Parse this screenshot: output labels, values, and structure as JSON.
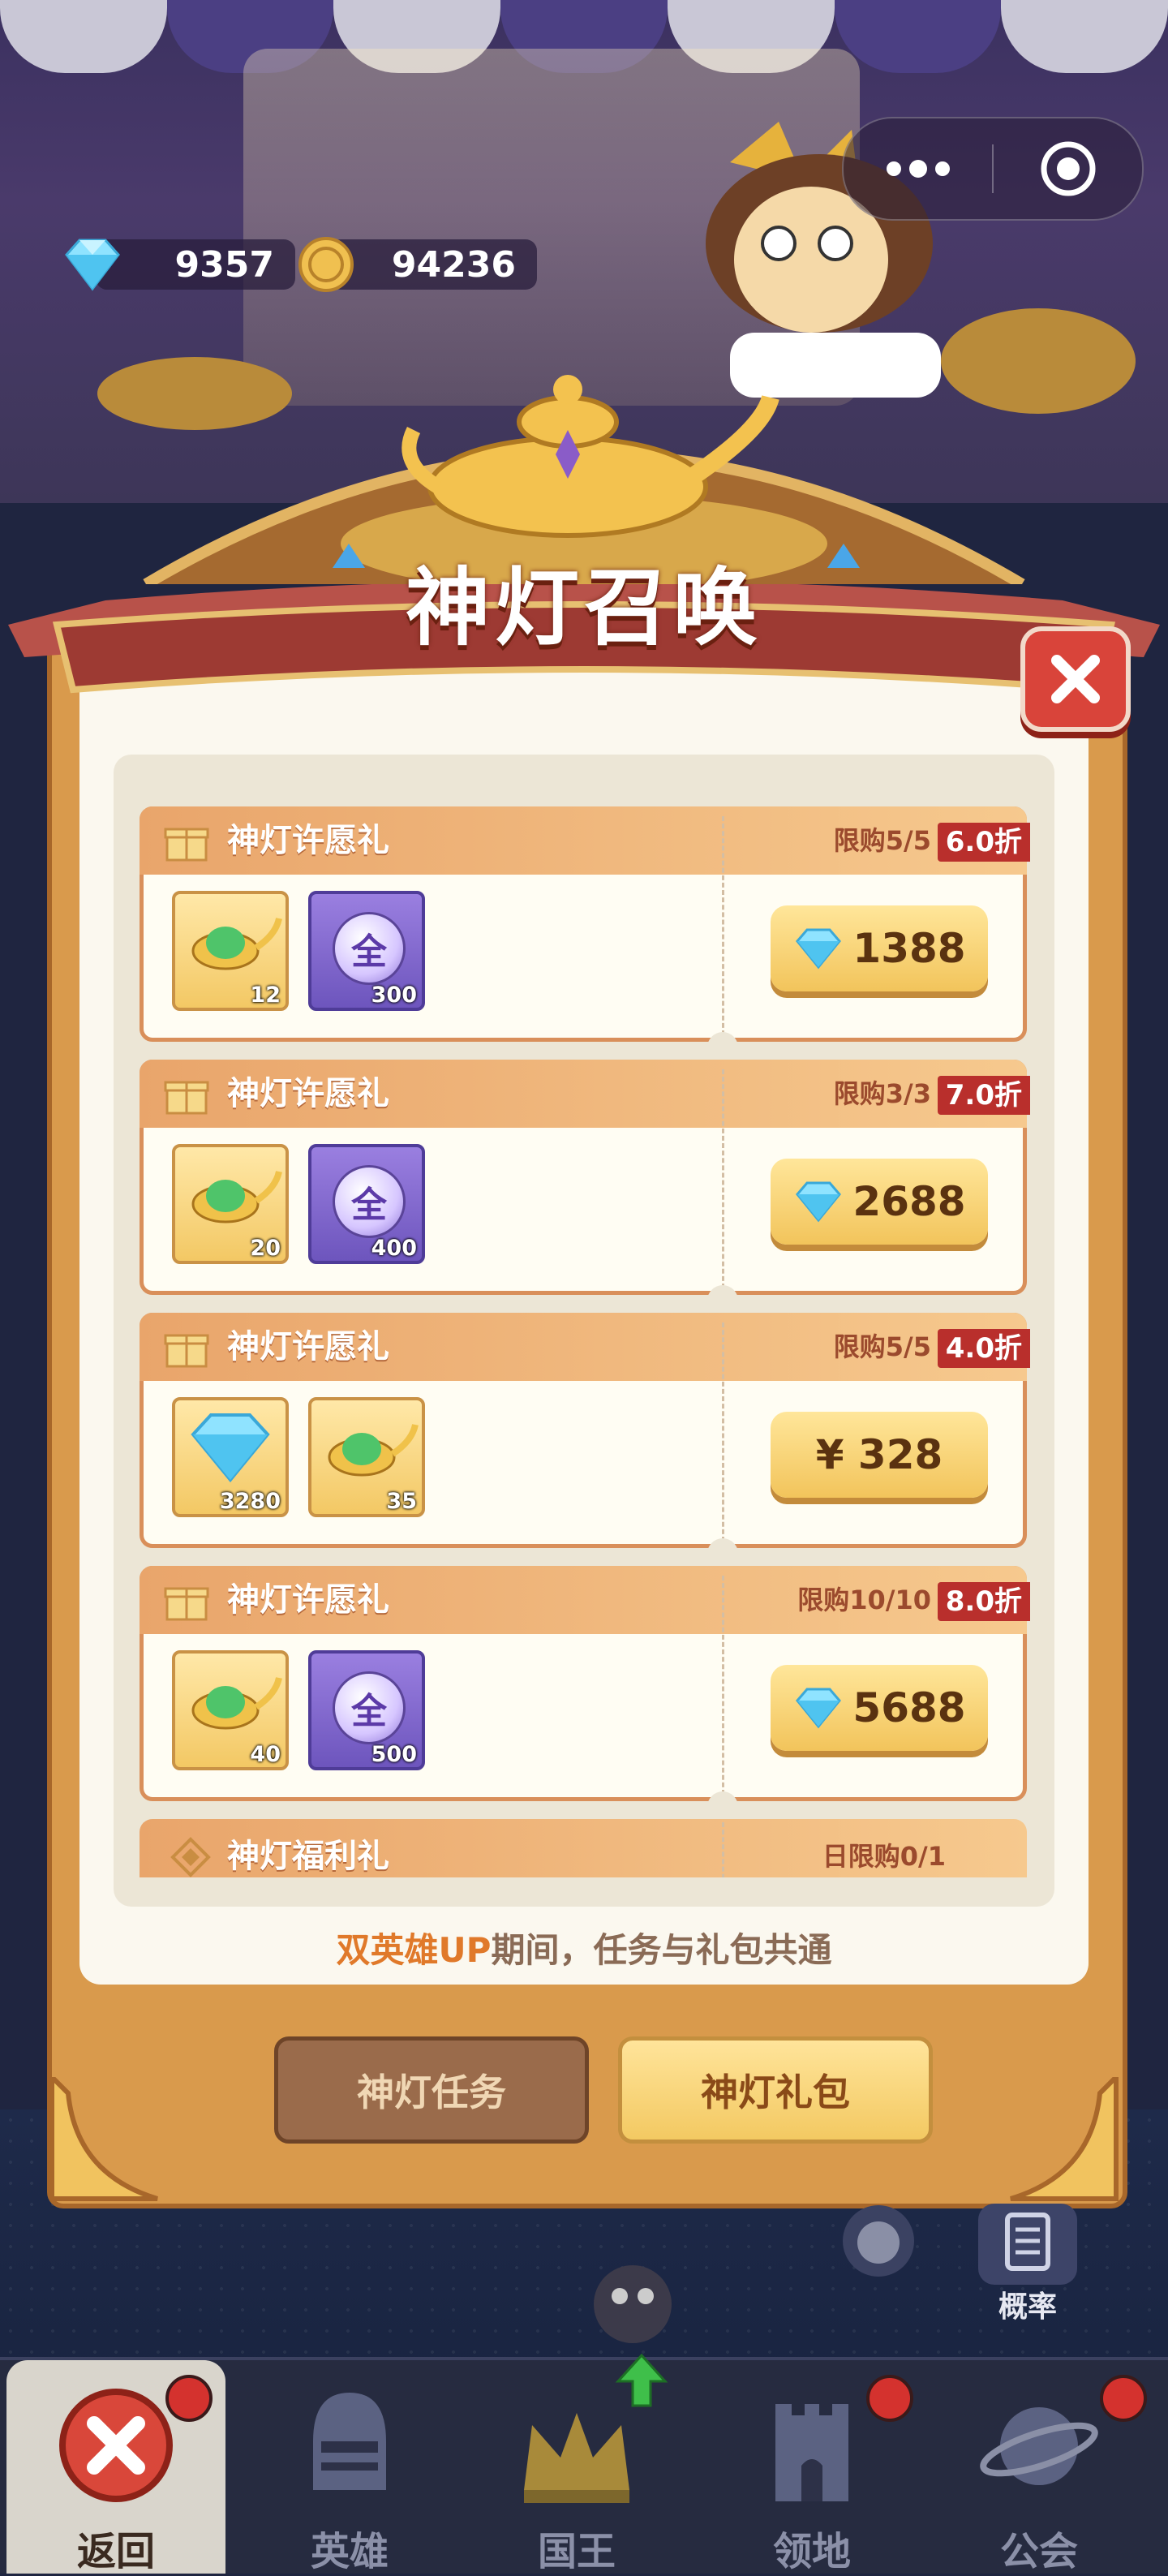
{
  "currency": {
    "gems": "9357",
    "coins": "94236"
  },
  "window_controls": {
    "more_icon": "more-dots-icon",
    "close_icon": "target-circle-icon"
  },
  "panel": {
    "title": "神灯召唤",
    "close_icon": "close-x-icon"
  },
  "gift_packs": [
    {
      "title": "神灯许愿礼",
      "limit": "限购5/5",
      "discount": "6.0折",
      "items": [
        {
          "icon": "magic-lamp-icon",
          "qty": "12"
        },
        {
          "icon": "all-hero-orb-icon",
          "qty": "300"
        }
      ],
      "price_icon": "gem-icon",
      "price": "1388"
    },
    {
      "title": "神灯许愿礼",
      "limit": "限购3/3",
      "discount": "7.0折",
      "items": [
        {
          "icon": "magic-lamp-icon",
          "qty": "20"
        },
        {
          "icon": "all-hero-orb-icon",
          "qty": "400"
        }
      ],
      "price_icon": "gem-icon",
      "price": "2688"
    },
    {
      "title": "神灯许愿礼",
      "limit": "限购5/5",
      "discount": "4.0折",
      "items": [
        {
          "icon": "gem-icon",
          "qty": "3280"
        },
        {
          "icon": "magic-lamp-icon",
          "qty": "35"
        }
      ],
      "price_icon": "yuan-icon",
      "price": "¥ 328"
    },
    {
      "title": "神灯许愿礼",
      "limit": "限购10/10",
      "discount": "8.0折",
      "items": [
        {
          "icon": "magic-lamp-icon",
          "qty": "40"
        },
        {
          "icon": "all-hero-orb-icon",
          "qty": "500"
        }
      ],
      "price_icon": "gem-icon",
      "price": "5688"
    },
    {
      "title": "神灯福利礼",
      "limit": "日限购0/1"
    }
  ],
  "orb_glyph": "全",
  "footnote": {
    "highlight": "双英雄UP",
    "rest": "期间，任务与礼包共通"
  },
  "tabs": {
    "task": "神灯任务",
    "gift": "神灯礼包"
  },
  "side": {
    "probability": "概率"
  },
  "nav": [
    {
      "label": "返回",
      "icon": "close-x-icon",
      "badge": true
    },
    {
      "label": "英雄",
      "icon": "knight-helmet-icon",
      "badge": false
    },
    {
      "label": "国王",
      "icon": "crown-icon",
      "badge": false,
      "upgrade": true
    },
    {
      "label": "领地",
      "icon": "castle-tower-icon",
      "badge": true
    },
    {
      "label": "公会",
      "icon": "planet-icon",
      "badge": true
    }
  ]
}
